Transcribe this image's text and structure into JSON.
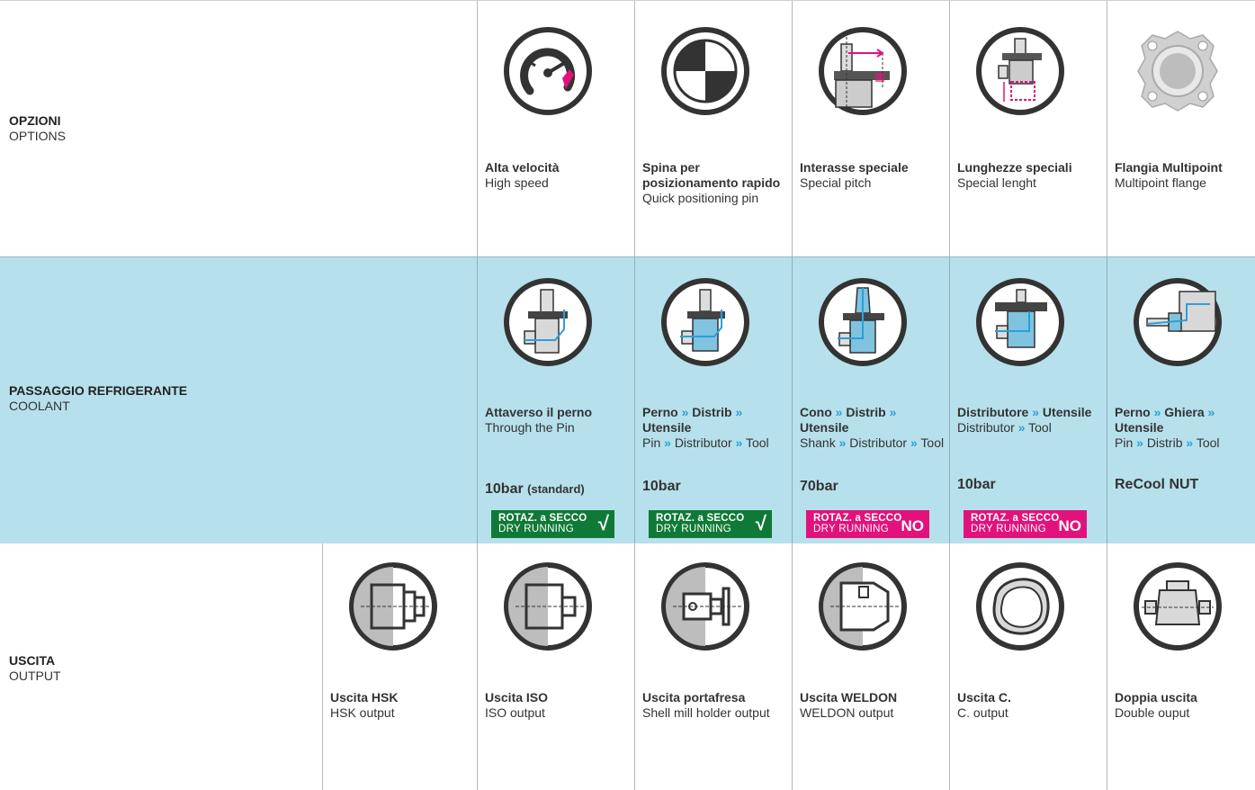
{
  "options": {
    "title_it": "OPZIONI",
    "title_en": "OPTIONS",
    "items": [
      {
        "it": "Alta velocità",
        "en": "High speed",
        "icon": "speedometer-icon"
      },
      {
        "it": "Spina per posizionamento rapido",
        "en": "Quick positioning pin",
        "icon": "quadrant-disc-icon"
      },
      {
        "it": "Interasse speciale",
        "en": "Special pitch",
        "icon": "special-pitch-icon"
      },
      {
        "it": "Lunghezze speciali",
        "en": "Special lenght",
        "icon": "special-length-icon"
      },
      {
        "it": "Flangia Multipoint",
        "en": "Multipoint flange",
        "icon": "multipoint-flange-icon"
      }
    ]
  },
  "coolant": {
    "title_it": "PASSAGGIO REFRIGERANTE",
    "title_en": "COOLANT",
    "arrow": "»",
    "items": [
      {
        "it_parts": [
          "Attaverso il perno"
        ],
        "en_parts": [
          "Through the Pin"
        ],
        "pressure": "10bar",
        "pressure_note": "(standard)",
        "badge_l1": "ROTAZ. a SECCO",
        "badge_l2": "DRY RUNNING",
        "badge_mark": "√",
        "badge_status": "ok"
      },
      {
        "it_parts": [
          "Perno",
          "Distrib",
          "Utensile"
        ],
        "en_parts": [
          "Pin",
          "Distributor",
          "Tool"
        ],
        "pressure": "10bar",
        "pressure_note": "",
        "badge_l1": "ROTAZ. a SECCO",
        "badge_l2": "DRY RUNNING",
        "badge_mark": "√",
        "badge_status": "ok"
      },
      {
        "it_parts": [
          "Cono",
          "Distrib",
          "Utensile"
        ],
        "en_parts": [
          "Shank",
          "Distributor",
          "Tool"
        ],
        "pressure": "70bar",
        "pressure_note": "",
        "badge_l1": "ROTAZ. a SECCO",
        "badge_l2": "DRY RUNNING",
        "badge_mark": "NO",
        "badge_status": "no"
      },
      {
        "it_parts": [
          "Distributore",
          "Utensile"
        ],
        "en_parts": [
          "Distributor",
          "Tool"
        ],
        "pressure": "10bar",
        "pressure_note": "",
        "badge_l1": "ROTAZ. a SECCO",
        "badge_l2": "DRY RUNNING",
        "badge_mark": "NO",
        "badge_status": "no"
      },
      {
        "it_parts": [
          "Perno",
          "Ghiera",
          "Utensile"
        ],
        "en_parts": [
          "Pin",
          "Distrib",
          "Tool"
        ],
        "pressure": "ReCool NUT",
        "pressure_note": "",
        "badge_l1": "",
        "badge_l2": "",
        "badge_mark": "",
        "badge_status": "none"
      }
    ]
  },
  "output": {
    "title_it": "USCITA",
    "title_en": "OUTPUT",
    "items": [
      {
        "it": "Uscita HSK",
        "en": "HSK output",
        "icon": "hsk-output-icon"
      },
      {
        "it": "Uscita ISO",
        "en": "ISO output",
        "icon": "iso-output-icon"
      },
      {
        "it": "Uscita portafresa",
        "en": "Shell mill holder output",
        "icon": "shell-mill-output-icon"
      },
      {
        "it": "Uscita WELDON",
        "en": "WELDON output",
        "icon": "weldon-output-icon"
      },
      {
        "it": "Uscita C.",
        "en": "C. output",
        "icon": "c-output-icon"
      },
      {
        "it": "Doppia uscita",
        "en": "Double ouput",
        "icon": "double-output-icon"
      }
    ]
  },
  "colors": {
    "accent_pink": "#e2127c",
    "coolant_blue": "#2aa0d8",
    "row_bg": "#b6e0ec",
    "ok_green": "#0f7a37",
    "icon_dark": "#333333"
  }
}
